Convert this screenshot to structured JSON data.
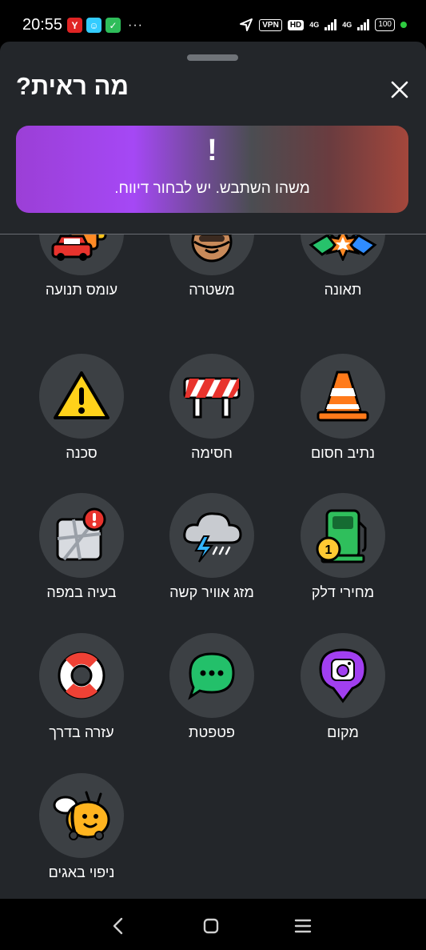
{
  "status_bar": {
    "time": "20:55",
    "app_icons": [
      {
        "icon": "red-app-icon",
        "color": "#e02424",
        "glyph": "Y"
      },
      {
        "icon": "waze-app-icon",
        "color": "#33ccff",
        "glyph": "☺"
      },
      {
        "icon": "shield-app-icon",
        "color": "#2ebd5a",
        "glyph": "✓"
      }
    ],
    "more": "···",
    "vpn": "VPN",
    "hd": "HD",
    "net1": "4G",
    "net2": "4G",
    "battery": "100"
  },
  "sheet": {
    "title": "מה ראית?",
    "error_mark": "!",
    "error_message": "משהו השתבש. יש לבחור דיווח."
  },
  "reports": [
    {
      "label": "תאונה",
      "icon": "crash-icon"
    },
    {
      "label": "משטרה",
      "icon": "police-icon"
    },
    {
      "label": "עומס תנועה",
      "icon": "traffic-jam-icon"
    },
    {
      "label": "נתיב חסום",
      "icon": "traffic-cone-icon"
    },
    {
      "label": "חסימה",
      "icon": "road-barrier-icon"
    },
    {
      "label": "סכנה",
      "icon": "hazard-warning-icon"
    },
    {
      "label": "מחירי דלק",
      "icon": "gas-pump-icon"
    },
    {
      "label": "מזג אוויר קשה",
      "icon": "storm-cloud-icon"
    },
    {
      "label": "בעיה במפה",
      "icon": "map-issue-icon"
    },
    {
      "label": "מקום",
      "icon": "place-camera-icon"
    },
    {
      "label": "פטפטת",
      "icon": "chat-bubble-icon"
    },
    {
      "label": "עזרה בדרך",
      "icon": "lifebuoy-icon"
    },
    {
      "label": "ניפוי באגים",
      "icon": "bug-bee-icon"
    }
  ]
}
